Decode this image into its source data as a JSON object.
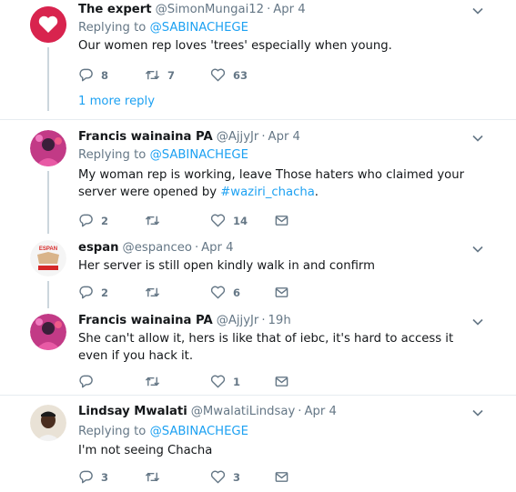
{
  "tweets": [
    {
      "name": "The expert",
      "handle": "@SimonMungai12",
      "sep": "·",
      "time": "Apr 4",
      "replying_prefix": "Replying to",
      "replying_user": "@SABINACHEGE",
      "text": "Our women rep loves 'trees' especially when young.",
      "replies": "8",
      "retweets": "7",
      "likes": "63"
    },
    {
      "name": "Francis wainaina PA",
      "handle": "@AjjyJr",
      "sep": "·",
      "time": "Apr 4",
      "replying_prefix": "Replying to",
      "replying_user": "@SABINACHEGE",
      "text_before": "My woman rep is working, leave Those haters who claimed your server were opened by ",
      "hashtag": "#waziri_chacha",
      "text_after": ".",
      "replies": "2",
      "retweets": "",
      "likes": "14"
    },
    {
      "name": "espan",
      "handle": "@espanceo",
      "sep": "·",
      "time": "Apr 4",
      "text": "Her server is still open kindly walk in and confirm",
      "replies": "2",
      "retweets": "",
      "likes": "6",
      "avatar_text": "ESPAN"
    },
    {
      "name": "Francis wainaina PA",
      "handle": "@AjjyJr",
      "sep": "·",
      "time": "19h",
      "text": "She can't allow it, hers is like that of iebc, it's hard to access it even if you hack it.",
      "replies": "",
      "retweets": "",
      "likes": "1"
    },
    {
      "name": "Lindsay Mwalati",
      "handle": "@MwalatiLindsay",
      "sep": "·",
      "time": "Apr 4",
      "replying_prefix": "Replying to",
      "replying_user": "@SABINACHEGE",
      "text": "I'm not seeing Chacha",
      "replies": "3",
      "retweets": "",
      "likes": "3"
    }
  ],
  "more_reply": "1 more reply",
  "colors": {
    "link": "#1da1f2",
    "muted": "#657786",
    "text": "#14171a",
    "divider": "#e6ecf0",
    "thread_line": "#ccd6dd"
  },
  "icons": {
    "reply": "reply-icon",
    "retweet": "retweet-icon",
    "like": "heart-icon",
    "dm": "direct-message-icon",
    "caret": "chevron-down-icon"
  }
}
